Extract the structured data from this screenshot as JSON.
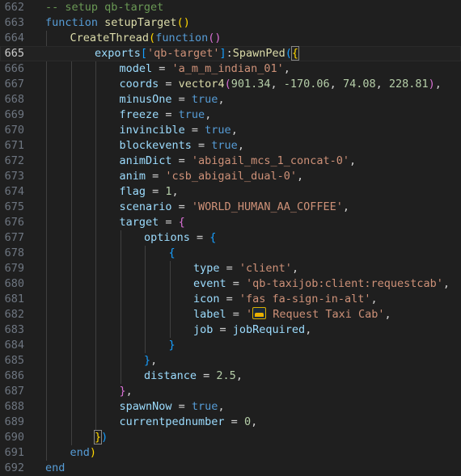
{
  "editor": {
    "theme_colors": {
      "background": "#1f1f1f",
      "comment": "#6a9955",
      "keyword": "#569cd6",
      "function": "#dcdcaa",
      "string": "#ce9178",
      "number": "#b5cea8",
      "property": "#9cdcfe",
      "brace_level1": "#ffd700",
      "brace_level2": "#da70d6",
      "brace_level3": "#179fff"
    },
    "current_line": 665,
    "lines": [
      {
        "number": "662",
        "indent": 0,
        "tokens": [
          {
            "t": "-- setup qb-target",
            "c": "comment"
          }
        ]
      },
      {
        "number": "663",
        "indent": 0,
        "tokens": [
          {
            "t": "function ",
            "c": "keyword"
          },
          {
            "t": "setupTarget",
            "c": "function"
          },
          {
            "t": "()",
            "c": "brace1"
          }
        ]
      },
      {
        "number": "664",
        "indent": 1,
        "tokens": [
          {
            "t": "CreateThread",
            "c": "function"
          },
          {
            "t": "(",
            "c": "brace1"
          },
          {
            "t": "function",
            "c": "keyword"
          },
          {
            "t": "()",
            "c": "brace2"
          }
        ]
      },
      {
        "number": "665",
        "indent": 2,
        "tokens": [
          {
            "t": "exports",
            "c": "property"
          },
          {
            "t": "[",
            "c": "brace3"
          },
          {
            "t": "'qb-target'",
            "c": "string"
          },
          {
            "t": "]",
            "c": "brace3"
          },
          {
            "t": ":",
            "c": "punct"
          },
          {
            "t": "SpawnPed",
            "c": "function"
          },
          {
            "t": "(",
            "c": "brace3"
          },
          {
            "t": "{",
            "c": "brace1",
            "hl": true
          }
        ]
      },
      {
        "number": "666",
        "indent": 3,
        "tokens": [
          {
            "t": "model",
            "c": "property"
          },
          {
            "t": " = ",
            "c": "op"
          },
          {
            "t": "'a_m_m_indian_01'",
            "c": "string"
          },
          {
            "t": ",",
            "c": "punct"
          }
        ]
      },
      {
        "number": "667",
        "indent": 3,
        "tokens": [
          {
            "t": "coords",
            "c": "property"
          },
          {
            "t": " = ",
            "c": "op"
          },
          {
            "t": "vector4",
            "c": "function"
          },
          {
            "t": "(",
            "c": "brace2"
          },
          {
            "t": "901.34",
            "c": "number"
          },
          {
            "t": ", ",
            "c": "punct"
          },
          {
            "t": "-170.06",
            "c": "number"
          },
          {
            "t": ", ",
            "c": "punct"
          },
          {
            "t": "74.08",
            "c": "number"
          },
          {
            "t": ", ",
            "c": "punct"
          },
          {
            "t": "228.81",
            "c": "number"
          },
          {
            "t": ")",
            "c": "brace2"
          },
          {
            "t": ",",
            "c": "punct"
          }
        ]
      },
      {
        "number": "668",
        "indent": 3,
        "tokens": [
          {
            "t": "minusOne",
            "c": "property"
          },
          {
            "t": " = ",
            "c": "op"
          },
          {
            "t": "true",
            "c": "keyword"
          },
          {
            "t": ",",
            "c": "punct"
          }
        ]
      },
      {
        "number": "669",
        "indent": 3,
        "tokens": [
          {
            "t": "freeze",
            "c": "property"
          },
          {
            "t": " = ",
            "c": "op"
          },
          {
            "t": "true",
            "c": "keyword"
          },
          {
            "t": ",",
            "c": "punct"
          }
        ]
      },
      {
        "number": "670",
        "indent": 3,
        "tokens": [
          {
            "t": "invincible",
            "c": "property"
          },
          {
            "t": " = ",
            "c": "op"
          },
          {
            "t": "true",
            "c": "keyword"
          },
          {
            "t": ",",
            "c": "punct"
          }
        ]
      },
      {
        "number": "671",
        "indent": 3,
        "tokens": [
          {
            "t": "blockevents",
            "c": "property"
          },
          {
            "t": " = ",
            "c": "op"
          },
          {
            "t": "true",
            "c": "keyword"
          },
          {
            "t": ",",
            "c": "punct"
          }
        ]
      },
      {
        "number": "672",
        "indent": 3,
        "tokens": [
          {
            "t": "animDict",
            "c": "property"
          },
          {
            "t": " = ",
            "c": "op"
          },
          {
            "t": "'abigail_mcs_1_concat-0'",
            "c": "string"
          },
          {
            "t": ",",
            "c": "punct"
          }
        ]
      },
      {
        "number": "673",
        "indent": 3,
        "tokens": [
          {
            "t": "anim",
            "c": "property"
          },
          {
            "t": " = ",
            "c": "op"
          },
          {
            "t": "'csb_abigail_dual-0'",
            "c": "string"
          },
          {
            "t": ",",
            "c": "punct"
          }
        ]
      },
      {
        "number": "674",
        "indent": 3,
        "tokens": [
          {
            "t": "flag",
            "c": "property"
          },
          {
            "t": " = ",
            "c": "op"
          },
          {
            "t": "1",
            "c": "number"
          },
          {
            "t": ",",
            "c": "punct"
          }
        ]
      },
      {
        "number": "675",
        "indent": 3,
        "tokens": [
          {
            "t": "scenario",
            "c": "property"
          },
          {
            "t": " = ",
            "c": "op"
          },
          {
            "t": "'WORLD_HUMAN_AA_COFFEE'",
            "c": "string"
          },
          {
            "t": ",",
            "c": "punct"
          }
        ]
      },
      {
        "number": "676",
        "indent": 3,
        "tokens": [
          {
            "t": "target",
            "c": "property"
          },
          {
            "t": " = ",
            "c": "op"
          },
          {
            "t": "{",
            "c": "brace2"
          }
        ]
      },
      {
        "number": "677",
        "indent": 4,
        "tokens": [
          {
            "t": "options",
            "c": "property"
          },
          {
            "t": " = ",
            "c": "op"
          },
          {
            "t": "{",
            "c": "brace3"
          }
        ]
      },
      {
        "number": "678",
        "indent": 5,
        "tokens": [
          {
            "t": "{",
            "c": "brace3"
          }
        ]
      },
      {
        "number": "679",
        "indent": 6,
        "tokens": [
          {
            "t": "type",
            "c": "property"
          },
          {
            "t": " = ",
            "c": "op"
          },
          {
            "t": "'client'",
            "c": "string"
          },
          {
            "t": ",",
            "c": "punct"
          }
        ]
      },
      {
        "number": "680",
        "indent": 6,
        "tokens": [
          {
            "t": "event",
            "c": "property"
          },
          {
            "t": " = ",
            "c": "op"
          },
          {
            "t": "'qb-taxijob:client:requestcab'",
            "c": "string"
          },
          {
            "t": ",",
            "c": "punct"
          }
        ]
      },
      {
        "number": "681",
        "indent": 6,
        "tokens": [
          {
            "t": "icon",
            "c": "property"
          },
          {
            "t": " = ",
            "c": "op"
          },
          {
            "t": "'fas fa-sign-in-alt'",
            "c": "string"
          },
          {
            "t": ",",
            "c": "punct"
          }
        ]
      },
      {
        "number": "682",
        "indent": 6,
        "tokens": [
          {
            "t": "label",
            "c": "property"
          },
          {
            "t": " = ",
            "c": "op"
          },
          {
            "t": "'",
            "c": "string"
          },
          {
            "t": "",
            "c": "emoji"
          },
          {
            "t": " Request Taxi Cab'",
            "c": "string"
          },
          {
            "t": ",",
            "c": "punct"
          }
        ]
      },
      {
        "number": "683",
        "indent": 6,
        "tokens": [
          {
            "t": "job",
            "c": "property"
          },
          {
            "t": " = ",
            "c": "op"
          },
          {
            "t": "jobRequired",
            "c": "property"
          },
          {
            "t": ",",
            "c": "punct"
          }
        ]
      },
      {
        "number": "684",
        "indent": 5,
        "tokens": [
          {
            "t": "}",
            "c": "brace3"
          }
        ]
      },
      {
        "number": "685",
        "indent": 4,
        "tokens": [
          {
            "t": "}",
            "c": "brace3"
          },
          {
            "t": ",",
            "c": "punct"
          }
        ]
      },
      {
        "number": "686",
        "indent": 4,
        "tokens": [
          {
            "t": "distance",
            "c": "property"
          },
          {
            "t": " = ",
            "c": "op"
          },
          {
            "t": "2.5",
            "c": "number"
          },
          {
            "t": ",",
            "c": "punct"
          }
        ]
      },
      {
        "number": "687",
        "indent": 3,
        "tokens": [
          {
            "t": "}",
            "c": "brace2"
          },
          {
            "t": ",",
            "c": "punct"
          }
        ]
      },
      {
        "number": "688",
        "indent": 3,
        "tokens": [
          {
            "t": "spawnNow",
            "c": "property"
          },
          {
            "t": " = ",
            "c": "op"
          },
          {
            "t": "true",
            "c": "keyword"
          },
          {
            "t": ",",
            "c": "punct"
          }
        ]
      },
      {
        "number": "689",
        "indent": 3,
        "tokens": [
          {
            "t": "currentpednumber",
            "c": "property"
          },
          {
            "t": " = ",
            "c": "op"
          },
          {
            "t": "0",
            "c": "number"
          },
          {
            "t": ",",
            "c": "punct"
          }
        ]
      },
      {
        "number": "690",
        "indent": 2,
        "tokens": [
          {
            "t": "}",
            "c": "brace1",
            "hl": true
          },
          {
            "t": ")",
            "c": "brace3"
          }
        ]
      },
      {
        "number": "691",
        "indent": 1,
        "tokens": [
          {
            "t": "end",
            "c": "keyword"
          },
          {
            "t": ")",
            "c": "brace1"
          }
        ]
      },
      {
        "number": "692",
        "indent": 0,
        "tokens": [
          {
            "t": "end",
            "c": "keyword"
          }
        ]
      }
    ]
  }
}
